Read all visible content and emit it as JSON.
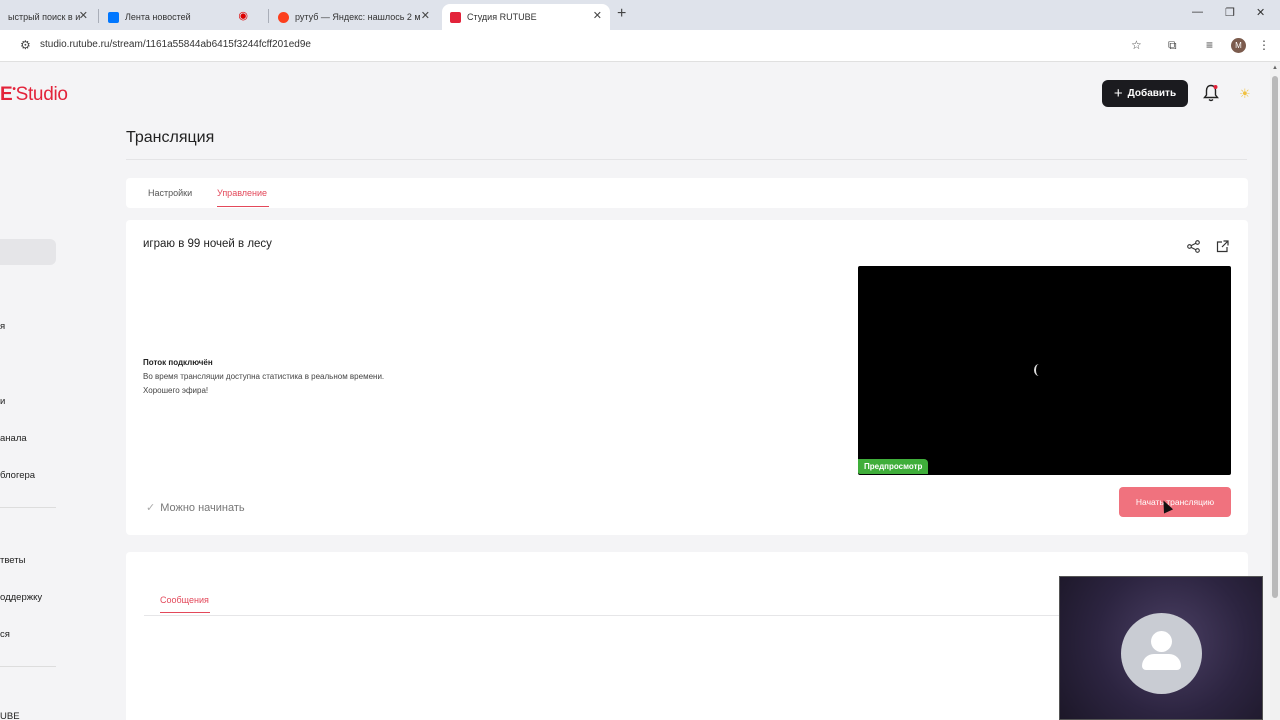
{
  "browser": {
    "tabs": [
      {
        "label": "ыстрый поиск в и",
        "color": "#4285f4"
      },
      {
        "label": "Лента новостей",
        "color": "#0077ff"
      },
      {
        "label": "рутуб — Яндекс: нашлось 2 м",
        "color": "#fc3f1d"
      },
      {
        "label": "Студия RUTUBE",
        "color": "#e3233a"
      }
    ],
    "new_tab": "+",
    "url": "studio.rutube.ru/stream/1161a55844ab6415f3244fcff201ed9e",
    "profile_initial": "M"
  },
  "header": {
    "logo_prefix": "E",
    "logo_text": "Studio",
    "add_label": "Добавить"
  },
  "sidebar": {
    "items": [
      "я",
      "и",
      "анала",
      "блогера",
      "тветы",
      "оддержку",
      "ся",
      "UBE"
    ]
  },
  "page": {
    "title": "Трансляция",
    "tabs": [
      "Настройки",
      "Управление"
    ],
    "active_tab": "Управление"
  },
  "stream": {
    "title": "играю в 99 ночей в лесу",
    "status_heading": "Поток подключён",
    "status_lines": [
      "Во время трансляции доступна статистика в реальном времени.",
      "Хорошего эфира!"
    ],
    "preview_badge": "Предпросмотр",
    "ready_label": "Можно начинать",
    "start_button": "Начать трансляцию"
  },
  "messages": {
    "tab_label": "Сообщения"
  },
  "colors": {
    "accent": "#e3485a",
    "brand": "#e3233a",
    "start_button": "#f0727e",
    "preview_badge": "#3fae3a"
  },
  "icons": [
    "share-icon",
    "external-link-icon",
    "bell-icon",
    "theme-icon",
    "plus-icon",
    "check-icon",
    "user-icon"
  ]
}
